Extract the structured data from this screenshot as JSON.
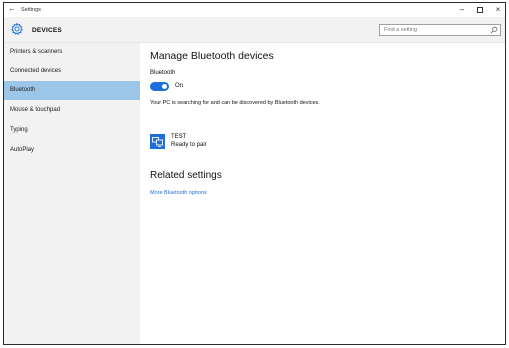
{
  "titlebar": {
    "back_glyph": "←",
    "title": "Settings",
    "minimize_glyph": "–",
    "close_glyph": "×"
  },
  "header": {
    "section_title": "DEVICES",
    "icon": "gear-icon",
    "search": {
      "placeholder": "Find a setting",
      "icon": "search-icon"
    }
  },
  "sidebar": {
    "items": [
      {
        "label": "Printers & scanners",
        "active": false
      },
      {
        "label": "Connected devices",
        "active": false
      },
      {
        "label": "Bluetooth",
        "active": true
      },
      {
        "label": "Mouse & touchpad",
        "active": false
      },
      {
        "label": "Typing",
        "active": false
      },
      {
        "label": "AutoPlay",
        "active": false
      }
    ]
  },
  "main": {
    "heading": "Manage Bluetooth devices",
    "bluetooth_label": "Bluetooth",
    "toggle_state": "On",
    "description": "Your PC is searching for and can be discovered by Bluetooth devices.",
    "device": {
      "name": "TEST",
      "status": "Ready to pair",
      "icon": "bluetooth-device-icon"
    },
    "related_heading": "Related settings",
    "related_link": "More Bluetooth options"
  },
  "colors": {
    "accent": "#1e6fd9",
    "sidebar_bg": "#f2f2f2",
    "active_item_bg": "#9cc6e8"
  }
}
